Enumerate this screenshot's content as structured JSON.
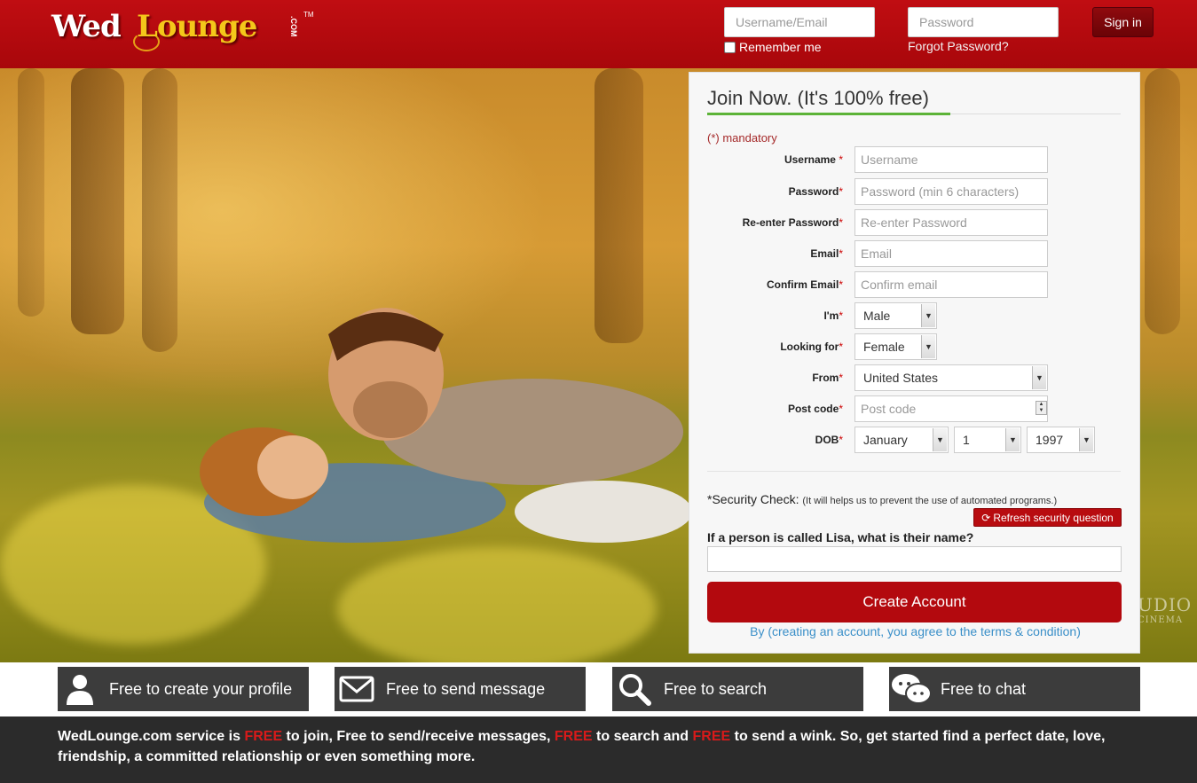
{
  "header": {
    "logo_text_wed": "Wed",
    "logo_text_lounge": "Lounge",
    "logo_dotcom": ".COM",
    "logo_tm": "TM",
    "username_placeholder": "Username/Email",
    "password_placeholder": "Password",
    "remember_label": "Remember me",
    "forgot_label": "Forgot Password?",
    "signin_label": "Sign in"
  },
  "hero": {
    "watermark_line1": "UDIO",
    "watermark_line2": "CINEMA"
  },
  "join": {
    "title": "Join Now. (It's 100% free)",
    "mandatory": "(*) mandatory",
    "required_mark": "*",
    "fields": {
      "username": {
        "label": "Username",
        "placeholder": "Username"
      },
      "password": {
        "label": "Password",
        "placeholder": "Password (min 6 characters)"
      },
      "repassword": {
        "label": "Re-enter Password",
        "placeholder": "Re-enter Password"
      },
      "email": {
        "label": "Email",
        "placeholder": "Email"
      },
      "confirm_email": {
        "label": "Confirm Email",
        "placeholder": "Confirm email"
      },
      "im": {
        "label": "I'm",
        "value": "Male"
      },
      "looking_for": {
        "label": "Looking for",
        "value": "Female"
      },
      "from": {
        "label": "From",
        "value": "United States"
      },
      "postcode": {
        "label": "Post code",
        "placeholder": "Post code"
      },
      "dob": {
        "label": "DOB",
        "month": "January",
        "day": "1",
        "year": "1997"
      }
    },
    "security_label": "*Security Check:",
    "security_note": "(It will helps us to prevent the use of automated programs.)",
    "refresh_label": "Refresh security question",
    "question": "If a person is called Lisa, what is their name?",
    "answer_value": "",
    "create_label": "Create Account",
    "terms": "By (creating an account, you agree to the terms & condition)"
  },
  "features": [
    {
      "label": "Free to create your profile",
      "icon": "user-icon"
    },
    {
      "label": "Free to send message",
      "icon": "envelope-icon"
    },
    {
      "label": "Free to search",
      "icon": "search-icon"
    },
    {
      "label": "Free to chat",
      "icon": "chat-icon"
    }
  ],
  "footer": {
    "p1": "WedLounge.com service is ",
    "free1": "FREE",
    "p2": " to join, Free to send/receive messages, ",
    "free2": "FREE",
    "p3": " to search and ",
    "free3": "FREE",
    "p4": " to send a wink. So, get started find a perfect date, love, friendship, a committed relationship or even something more."
  },
  "colors": {
    "brand_red": "#b0090e",
    "accent_green": "#5cb338",
    "link_blue": "#3a8fc8",
    "feature_bg": "#3c3c3c",
    "footer_bg": "#2b2b2b"
  }
}
